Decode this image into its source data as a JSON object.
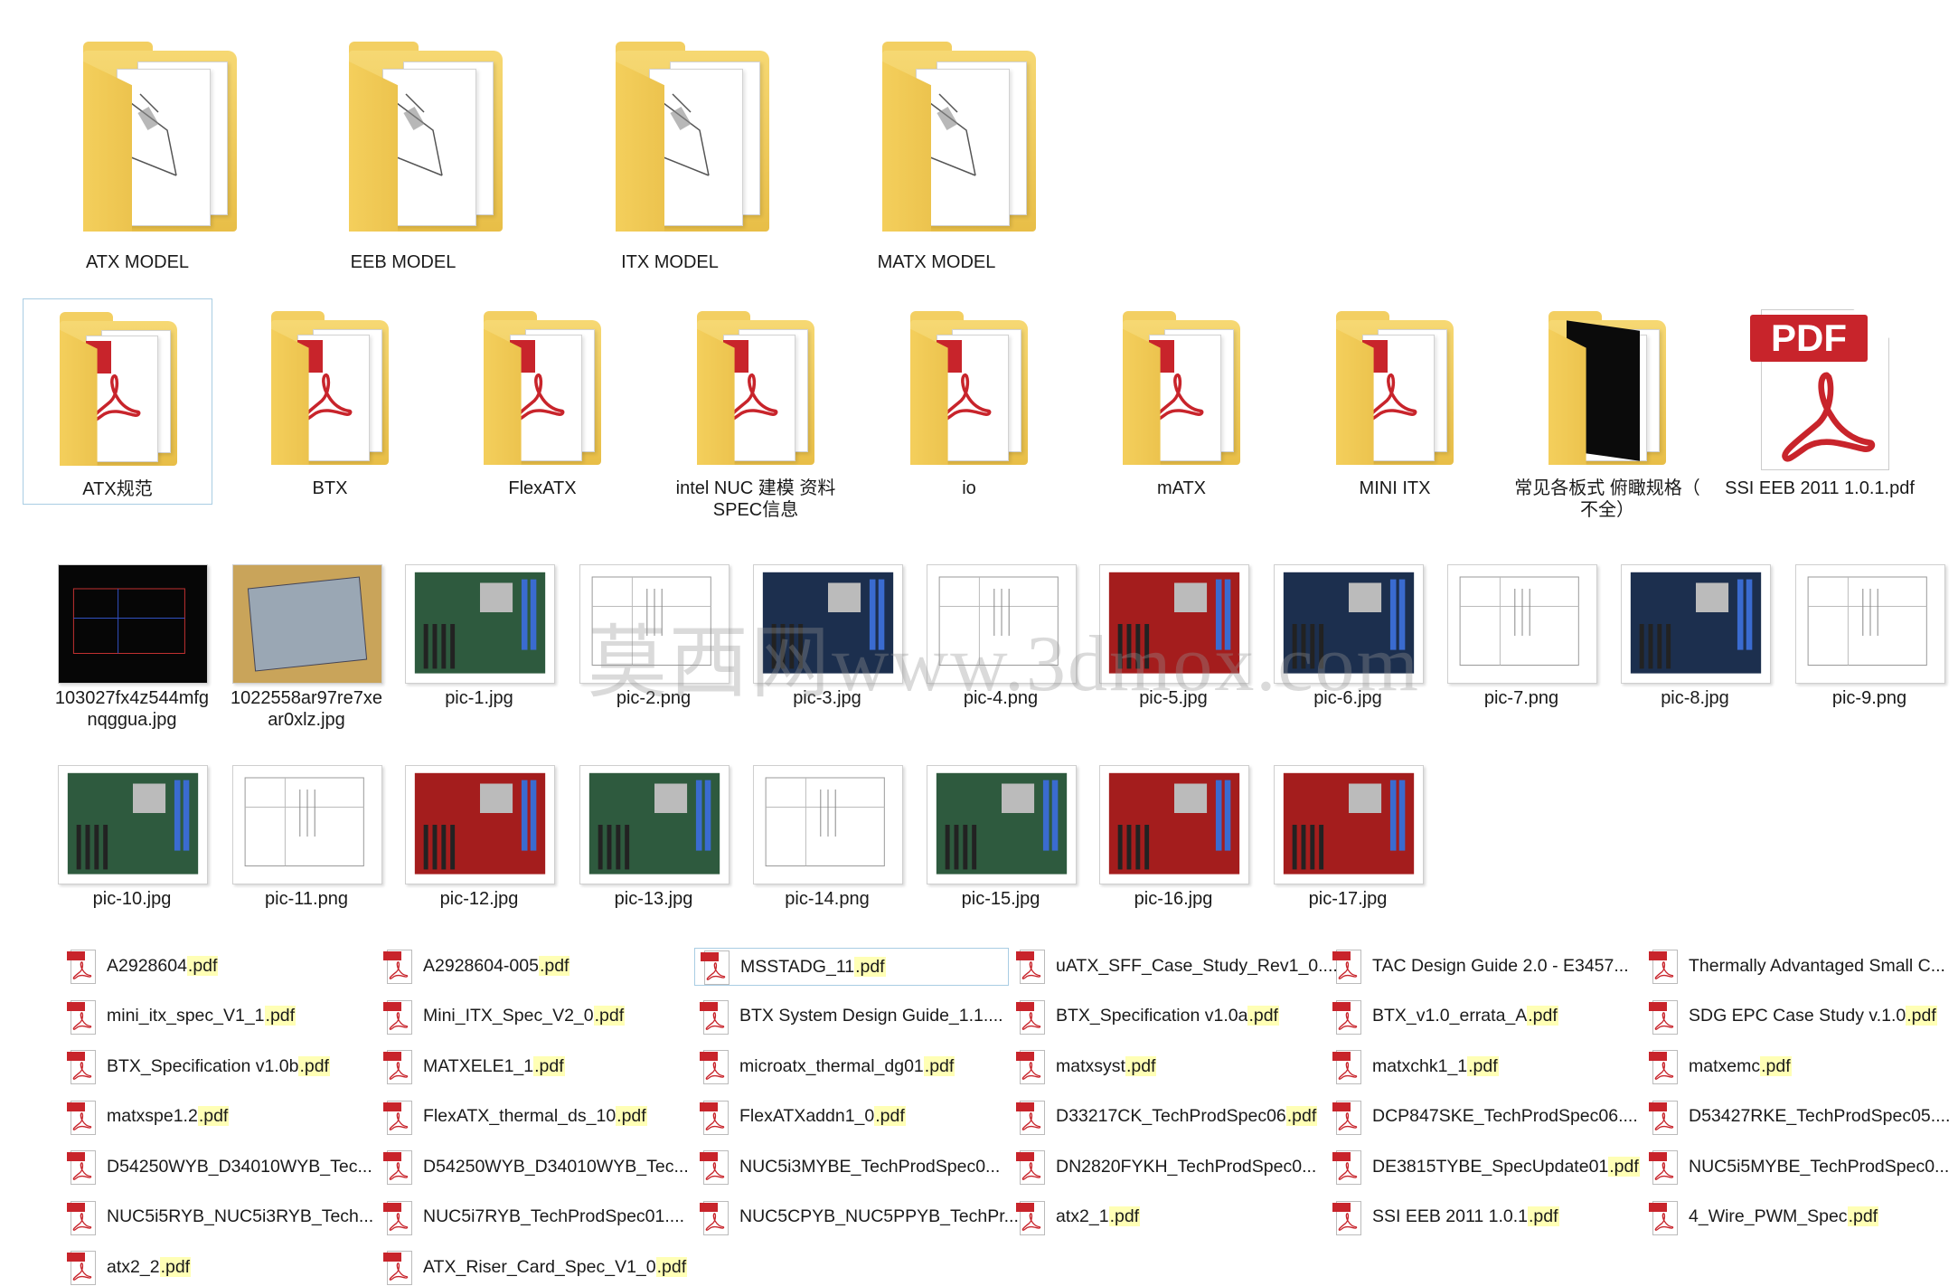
{
  "row1_folders": [
    {
      "label": "ATX MODEL",
      "icon": "folder-drawing-icon"
    },
    {
      "label": "EEB MODEL",
      "icon": "folder-drawing-icon"
    },
    {
      "label": "ITX MODEL",
      "icon": "folder-drawing-icon"
    },
    {
      "label": "MATX MODEL",
      "icon": "folder-drawing-icon"
    }
  ],
  "row2_items": [
    {
      "label": "ATX规范",
      "label2": "",
      "icon": "folder-pdf-icon",
      "selected": true
    },
    {
      "label": "BTX",
      "label2": "",
      "icon": "folder-pdf-icon"
    },
    {
      "label": "FlexATX",
      "label2": "",
      "icon": "folder-pdf-icon"
    },
    {
      "label": "intel NUC 建模 资料",
      "label2": "SPEC信息",
      "icon": "folder-pdf-icon"
    },
    {
      "label": "io",
      "label2": "",
      "icon": "folder-pdf-icon"
    },
    {
      "label": "mATX",
      "label2": "",
      "icon": "folder-pdf-icon"
    },
    {
      "label": "MINI ITX",
      "label2": "",
      "icon": "folder-pdf-icon"
    },
    {
      "label": "常见各板式 俯瞰规格（",
      "label2": "不全）",
      "icon": "folder-dark-drawing-icon"
    },
    {
      "label": "SSI EEB 2011 1.0.1.pdf",
      "label2": "",
      "icon": "pdf-file-icon",
      "pdf_text": "PDF"
    }
  ],
  "row3_images": [
    {
      "label": "103027fx4z544mfg",
      "label2": "nqggua.jpg",
      "style": "dark"
    },
    {
      "label": "1022558ar97re7xe",
      "label2": "ar0xlz.jpg",
      "style": "tan"
    },
    {
      "label": "pic-1.jpg",
      "label2": "",
      "style": "board-green"
    },
    {
      "label": "pic-2.png",
      "label2": "",
      "style": "drawing"
    },
    {
      "label": "pic-3.jpg",
      "label2": "",
      "style": "board-blue"
    },
    {
      "label": "pic-4.png",
      "label2": "",
      "style": "drawing"
    },
    {
      "label": "pic-5.jpg",
      "label2": "",
      "style": "board-red"
    },
    {
      "label": "pic-6.jpg",
      "label2": "",
      "style": "board-blue"
    },
    {
      "label": "pic-7.png",
      "label2": "",
      "style": "drawing"
    },
    {
      "label": "pic-8.jpg",
      "label2": "",
      "style": "board-blue"
    },
    {
      "label": "pic-9.png",
      "label2": "",
      "style": "drawing"
    }
  ],
  "row4_images": [
    {
      "label": "pic-10.jpg",
      "style": "board-green"
    },
    {
      "label": "pic-11.png",
      "style": "drawing"
    },
    {
      "label": "pic-12.jpg",
      "style": "board-red"
    },
    {
      "label": "pic-13.jpg",
      "style": "board-green"
    },
    {
      "label": "pic-14.png",
      "style": "drawing"
    },
    {
      "label": "pic-15.jpg",
      "style": "board-green"
    },
    {
      "label": "pic-16.jpg",
      "style": "board-red"
    },
    {
      "label": "pic-17.jpg",
      "style": "board-red"
    }
  ],
  "watermark": "莫西网www.3dmox.com",
  "pdf_list": {
    "columns": [
      [
        {
          "name": "A2928604",
          "ext": ".pdf"
        },
        {
          "name": "mini_itx_spec_V1_1",
          "ext": ".pdf"
        },
        {
          "name": "BTX_Specification v1.0b",
          "ext": ".pdf"
        },
        {
          "name": "matxspe1.2",
          "ext": ".pdf"
        },
        {
          "name": "D54250WYB_D34010WYB_Tec...",
          "ext": ""
        },
        {
          "name": "NUC5i5RYB_NUC5i3RYB_Tech...",
          "ext": ""
        },
        {
          "name": "atx2_2",
          "ext": ".pdf"
        }
      ],
      [
        {
          "name": "A2928604-005",
          "ext": ".pdf"
        },
        {
          "name": "Mini_ITX_Spec_V2_0",
          "ext": ".pdf"
        },
        {
          "name": "MATXELE1_1",
          "ext": ".pdf"
        },
        {
          "name": "FlexATX_thermal_ds_10",
          "ext": ".pdf"
        },
        {
          "name": "D54250WYB_D34010WYB_Tec...",
          "ext": ""
        },
        {
          "name": "NUC5i7RYB_TechProdSpec01....",
          "ext": ""
        },
        {
          "name": "ATX_Riser_Card_Spec_V1_0",
          "ext": ".pdf"
        }
      ],
      [
        {
          "name": "MSSTADG_11",
          "ext": ".pdf",
          "selected": true
        },
        {
          "name": "BTX System Design Guide_1.1....",
          "ext": ""
        },
        {
          "name": "microatx_thermal_dg01",
          "ext": ".pdf"
        },
        {
          "name": "FlexATXaddn1_0",
          "ext": ".pdf"
        },
        {
          "name": "NUC5i3MYBE_TechProdSpec0...",
          "ext": ""
        },
        {
          "name": "NUC5CPYB_NUC5PPYB_TechPr...",
          "ext": ""
        }
      ],
      [
        {
          "name": "uATX_SFF_Case_Study_Rev1_0....",
          "ext": ""
        },
        {
          "name": "BTX_Specification v1.0a",
          "ext": ".pdf"
        },
        {
          "name": "matxsyst",
          "ext": ".pdf"
        },
        {
          "name": "D33217CK_TechProdSpec06",
          "ext": ".pdf"
        },
        {
          "name": "DN2820FYKH_TechProdSpec0...",
          "ext": ""
        },
        {
          "name": "atx2_1",
          "ext": ".pdf"
        }
      ],
      [
        {
          "name": "TAC Design Guide 2.0 - E3457...",
          "ext": ""
        },
        {
          "name": "BTX_v1.0_errata_A",
          "ext": ".pdf"
        },
        {
          "name": "matxchk1_1",
          "ext": ".pdf"
        },
        {
          "name": "DCP847SKE_TechProdSpec06....",
          "ext": ""
        },
        {
          "name": "DE3815TYBE_SpecUpdate01",
          "ext": ".pdf"
        },
        {
          "name": "SSI EEB 2011 1.0.1",
          "ext": ".pdf"
        }
      ],
      [
        {
          "name": "Thermally Advantaged Small C...",
          "ext": ""
        },
        {
          "name": "SDG EPC Case Study v.1.0",
          "ext": ".pdf"
        },
        {
          "name": "matxemc",
          "ext": ".pdf"
        },
        {
          "name": "D53427RKE_TechProdSpec05....",
          "ext": ""
        },
        {
          "name": "NUC5i5MYBE_TechProdSpec0...",
          "ext": ""
        },
        {
          "name": "4_Wire_PWM_Spec",
          "ext": ".pdf"
        }
      ]
    ]
  },
  "colors": {
    "folder": "#f3cf62",
    "pdf_red": "#c8242b",
    "selection": "#a9cde3",
    "ext_highlight": "#ffffb5"
  }
}
